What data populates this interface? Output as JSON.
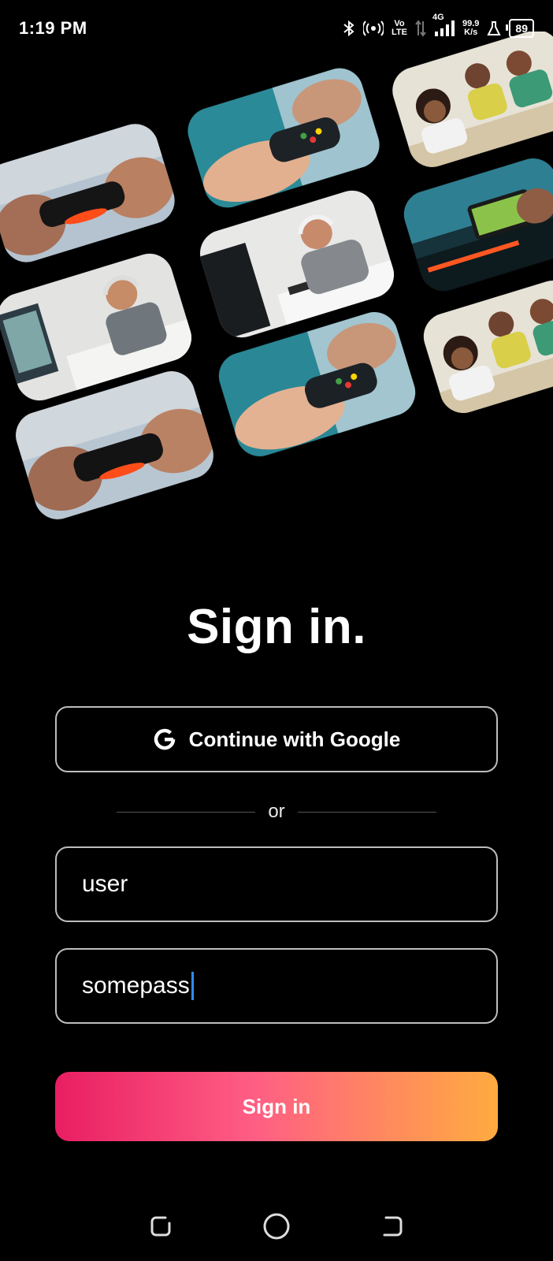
{
  "status_bar": {
    "time": "1:19 PM",
    "volte_top": "Vo",
    "volte_bottom": "LTE",
    "network": "4G",
    "speed_value": "99.9",
    "speed_unit": "K/s",
    "battery": "89",
    "icons": [
      "bluetooth-icon",
      "hotspot-icon",
      "volte-icon",
      "data-arrows-icon",
      "signal-icon",
      "flask-icon",
      "battery-icon"
    ]
  },
  "collage": {
    "images": [
      "controller-closeup",
      "handheld-controller",
      "family-boardgame",
      "phone-gaming",
      "gamer-headset-desk",
      "gamer-shouting",
      "family-boardgame",
      "handheld-controller",
      "controller-closeup"
    ]
  },
  "title": "Sign in.",
  "google_button": {
    "label": "Continue with Google",
    "icon": "google-icon"
  },
  "divider": {
    "text": "or"
  },
  "username_field": {
    "value": "user"
  },
  "password_field": {
    "value": "somepass"
  },
  "signin_button": {
    "label": "Sign in"
  },
  "colors": {
    "background": "#000000",
    "gradient_start": "#e91e63",
    "gradient_end": "#ffab40",
    "field_border": "#bdbdbd",
    "cursor": "#2f8cff"
  },
  "navbar": {
    "icons": [
      "recents-icon",
      "home-icon",
      "back-icon"
    ]
  }
}
